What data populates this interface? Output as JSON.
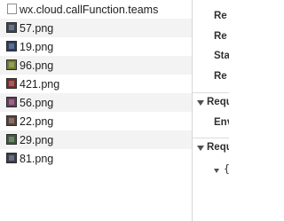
{
  "requests": [
    {
      "name": "wx.cloud.callFunction.teams",
      "icon": "file-icon"
    },
    {
      "name": "57.png",
      "icon": "image-thumbnail-icon",
      "thumb": "#3a4656"
    },
    {
      "name": "19.png",
      "icon": "image-thumbnail-icon",
      "thumb": "#2a3f63"
    },
    {
      "name": "96.png",
      "icon": "image-thumbnail-icon",
      "thumb": "#6f7a2c"
    },
    {
      "name": "421.png",
      "icon": "image-thumbnail-icon",
      "thumb": "#7a2b2b"
    },
    {
      "name": "56.png",
      "icon": "image-thumbnail-icon",
      "thumb": "#6b3a5a"
    },
    {
      "name": "22.png",
      "icon": "image-thumbnail-icon",
      "thumb": "#5b4338"
    },
    {
      "name": "29.png",
      "icon": "image-thumbnail-icon",
      "thumb": "#3e5a3d"
    },
    {
      "name": "81.png",
      "icon": "image-thumbnail-icon",
      "thumb": "#3b3f4c"
    }
  ],
  "details": {
    "general_labels": [
      "Re",
      "Re",
      "Sta",
      "Re"
    ],
    "sections": [
      {
        "title": "Requ",
        "rows": [
          "Env"
        ]
      },
      {
        "title": "Requ",
        "rows": [
          "{"
        ]
      }
    ]
  }
}
